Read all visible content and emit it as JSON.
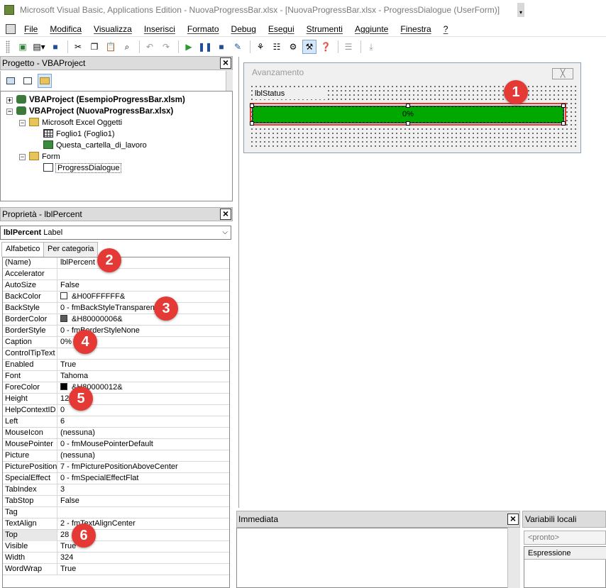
{
  "window": {
    "title": "Microsoft Visual Basic, Applications Edition - NuovaProgressBar.xlsx - [NuovaProgressBar.xlsx - ProgressDialogue (UserForm)]"
  },
  "menubar": {
    "items": [
      "File",
      "Modifica",
      "Visualizza",
      "Inserisci",
      "Formato",
      "Debug",
      "Esegui",
      "Strumenti",
      "Aggiunte",
      "Finestra",
      "?"
    ]
  },
  "project_panel": {
    "title": "Progetto - VBAProject",
    "tree": {
      "project1": "VBAProject (EsempioProgressBar.xlsm)",
      "project2": "VBAProject (NuovaProgressBar.xlsx)",
      "excel_objects": "Microsoft Excel Oggetti",
      "sheet1": "Foglio1 (Foglio1)",
      "workbook": "Questa_cartella_di_lavoro",
      "forms": "Form",
      "form1": "ProgressDialogue"
    }
  },
  "properties_panel": {
    "title": "Proprietà - lblPercent",
    "object_name": "lblPercent",
    "object_type": "Label",
    "tabs": [
      "Alfabetico",
      "Per categoria"
    ],
    "rows": [
      {
        "name": "(Name)",
        "value": "lblPercent"
      },
      {
        "name": "Accelerator",
        "value": ""
      },
      {
        "name": "AutoSize",
        "value": "False"
      },
      {
        "name": "BackColor",
        "value": "&H00FFFFFF&"
      },
      {
        "name": "BackStyle",
        "value": "0 - fmBackStyleTransparent"
      },
      {
        "name": "BorderColor",
        "value": "&H80000006&"
      },
      {
        "name": "BorderStyle",
        "value": "0 - fmBorderStyleNone"
      },
      {
        "name": "Caption",
        "value": "0%"
      },
      {
        "name": "ControlTipText",
        "value": ""
      },
      {
        "name": "Enabled",
        "value": "True"
      },
      {
        "name": "Font",
        "value": "Tahoma"
      },
      {
        "name": "ForeColor",
        "value": "&H80000012&"
      },
      {
        "name": "Height",
        "value": "12"
      },
      {
        "name": "HelpContextID",
        "value": "0"
      },
      {
        "name": "Left",
        "value": "6"
      },
      {
        "name": "MouseIcon",
        "value": "(nessuna)"
      },
      {
        "name": "MousePointer",
        "value": "0 - fmMousePointerDefault"
      },
      {
        "name": "Picture",
        "value": "(nessuna)"
      },
      {
        "name": "PicturePosition",
        "value": "7 - fmPicturePositionAboveCenter"
      },
      {
        "name": "SpecialEffect",
        "value": "0 - fmSpecialEffectFlat"
      },
      {
        "name": "TabIndex",
        "value": "3"
      },
      {
        "name": "TabStop",
        "value": "False"
      },
      {
        "name": "Tag",
        "value": ""
      },
      {
        "name": "TextAlign",
        "value": "2 - fmTextAlignCenter"
      },
      {
        "name": "Top",
        "value": "28"
      },
      {
        "name": "Visible",
        "value": "True"
      },
      {
        "name": "Width",
        "value": "324"
      },
      {
        "name": "WordWrap",
        "value": "True"
      }
    ],
    "swatches": {
      "BackColor": "#ffffff",
      "BorderColor": "#5a5a5a",
      "ForeColor": "#000000"
    }
  },
  "userform": {
    "title": "Avanzamento",
    "close_label": "╳",
    "label_status": "lblStatus",
    "progress_caption": "0%",
    "progress_color": "#00a800"
  },
  "badges": [
    "1",
    "2",
    "3",
    "4",
    "5",
    "6"
  ],
  "immediate": {
    "title": "Immediata"
  },
  "locals": {
    "title": "Variabili locali",
    "context": "<pronto>",
    "column": "Espressione"
  },
  "colors": {
    "badge": "#e53935",
    "highlight": "#e53935"
  }
}
